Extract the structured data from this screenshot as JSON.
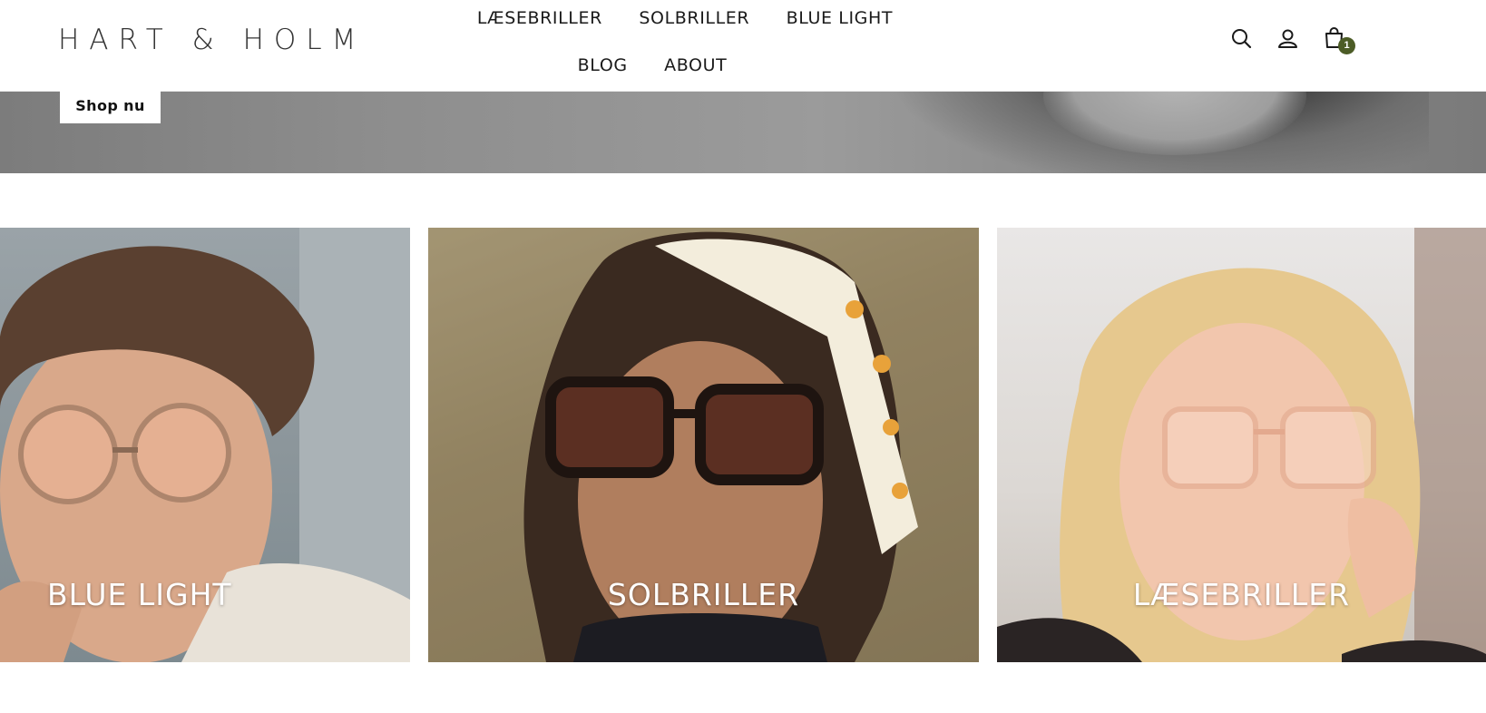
{
  "brand": {
    "logo": "HART & HOLM"
  },
  "nav": {
    "row1": [
      "LÆSEBRILLER",
      "SOLBRILLER",
      "BLUE LIGHT"
    ],
    "row2": [
      "BLOG",
      "ABOUT"
    ]
  },
  "header_icons": [
    "search-icon",
    "account-icon",
    "cart-icon"
  ],
  "cart": {
    "count": "1"
  },
  "hero": {
    "cta_label": "Shop nu"
  },
  "categories": [
    {
      "title": "BLUE LIGHT"
    },
    {
      "title": "SOLBRILLER"
    },
    {
      "title": "LÆSEBRILLER"
    }
  ],
  "colors": {
    "badge": "#4c5c26",
    "text": "#1a1a1a",
    "background": "#ffffff"
  }
}
